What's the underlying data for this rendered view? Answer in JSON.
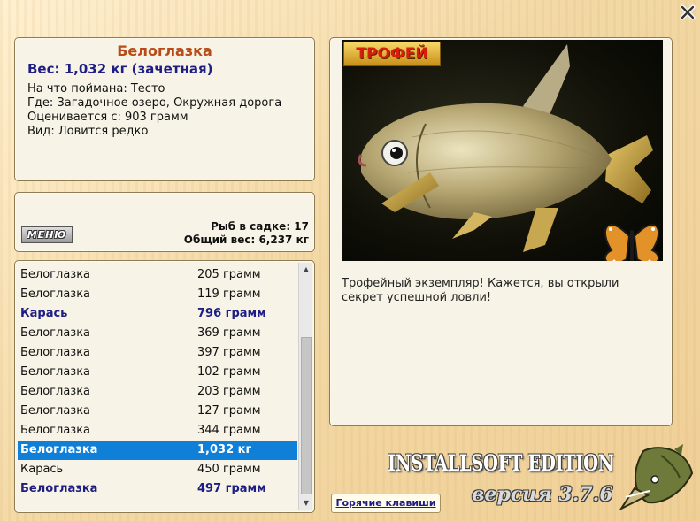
{
  "catch_info": {
    "name": "Белоглазка",
    "weight": "Вес: 1,032 кг (зачетная)",
    "bait": "На что поймана: Тесто",
    "place": "Где: Загадочное озеро, Окружная дорога",
    "valued_from": "Оценивается с: 903 грамм",
    "kind": "Вид: Ловится редко"
  },
  "keepnet": {
    "menu_label": "МЕНЮ",
    "fish_count": "Рыб в садке: 17",
    "total_weight": "Общий вес: 6,237 кг"
  },
  "catch_list": [
    {
      "name": "Белоглазка",
      "weight": "205 грамм",
      "style": "normal"
    },
    {
      "name": "Белоглазка",
      "weight": "119 грамм",
      "style": "normal"
    },
    {
      "name": "Карась",
      "weight": "796 грамм",
      "style": "trophy"
    },
    {
      "name": "Белоглазка",
      "weight": "369 грамм",
      "style": "normal"
    },
    {
      "name": "Белоглазка",
      "weight": "397 грамм",
      "style": "normal"
    },
    {
      "name": "Белоглазка",
      "weight": "102 грамм",
      "style": "normal"
    },
    {
      "name": "Белоглазка",
      "weight": "203 грамм",
      "style": "normal"
    },
    {
      "name": "Белоглазка",
      "weight": "127 грамм",
      "style": "normal"
    },
    {
      "name": "Белоглазка",
      "weight": "344 грамм",
      "style": "normal"
    },
    {
      "name": "Белоглазка",
      "weight": "1,032 кг",
      "style": "selected"
    },
    {
      "name": "Карась",
      "weight": "450 грамм",
      "style": "normal"
    },
    {
      "name": "Белоглазка",
      "weight": "497 грамм",
      "style": "trophy"
    }
  ],
  "photo": {
    "trophy_badge": "ТРОФЕЙ",
    "message": "Трофейный экземпляр! Кажется, вы открыли секрет успешной ловли!"
  },
  "footer": {
    "hotkeys_label": "Горячие клавиши",
    "edition": "INSTALLSOFT EDITION",
    "version": "версия 3.7.6"
  },
  "colors": {
    "selection": "#0f7fd8",
    "trophy_text": "#1d1d84",
    "fish_name": "#b84b16"
  },
  "icons": {
    "close": "close-icon",
    "butterfly": "butterfly-icon",
    "logo": "pike-logo"
  }
}
